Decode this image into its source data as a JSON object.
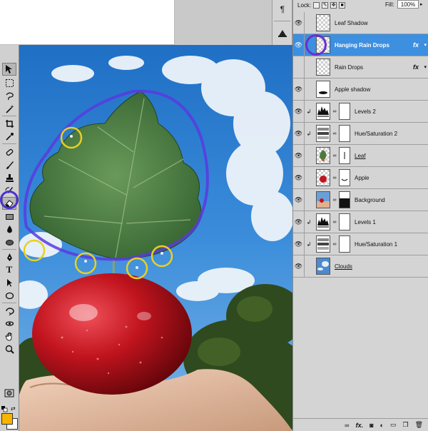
{
  "layers_panel": {
    "lock_label": "Lock:",
    "fill_label": "Fill:",
    "fill_value": "100%",
    "layers": [
      {
        "name": "Leaf Shadow",
        "visible": true,
        "selected": false,
        "fx": false,
        "clipped": false,
        "thumb": "transparent"
      },
      {
        "name": "Hanging Rain Drops",
        "visible": true,
        "selected": true,
        "fx": true,
        "clipped": false,
        "thumb": "transparent"
      },
      {
        "name": "Rain Drops",
        "visible": false,
        "selected": false,
        "fx": true,
        "clipped": false,
        "thumb": "transparent"
      },
      {
        "name": "Apple shadow",
        "visible": true,
        "selected": false,
        "fx": false,
        "clipped": false,
        "thumb": "shadow"
      },
      {
        "name": "Levels 2",
        "visible": true,
        "selected": false,
        "fx": false,
        "clipped": true,
        "thumb": "levels"
      },
      {
        "name": "Hue/Saturation 2",
        "visible": true,
        "selected": false,
        "fx": false,
        "clipped": true,
        "thumb": "huesat"
      },
      {
        "name": "Leaf",
        "visible": true,
        "selected": false,
        "fx": false,
        "clipped": false,
        "thumb": "leaf"
      },
      {
        "name": "Apple",
        "visible": true,
        "selected": false,
        "fx": false,
        "clipped": false,
        "thumb": "apple"
      },
      {
        "name": "Background",
        "visible": true,
        "selected": false,
        "fx": false,
        "clipped": false,
        "thumb": "background"
      },
      {
        "name": "Levels 1",
        "visible": true,
        "selected": false,
        "fx": false,
        "clipped": true,
        "thumb": "levels"
      },
      {
        "name": "Hue/Saturation 1",
        "visible": true,
        "selected": false,
        "fx": false,
        "clipped": true,
        "thumb": "huesat"
      },
      {
        "name": "Clouds",
        "visible": true,
        "selected": false,
        "fx": false,
        "clipped": false,
        "thumb": "clouds"
      }
    ],
    "fx_label": "fx"
  },
  "toolbox": {
    "foreground_color": "#f7b500",
    "background_color": "#ffffff",
    "active_tool": "eraser-tool"
  },
  "colors": {
    "selected_layer": "#3d8fe0",
    "highlight_ring": "#4a2fd1",
    "droplet_circle": "#e8d020"
  }
}
